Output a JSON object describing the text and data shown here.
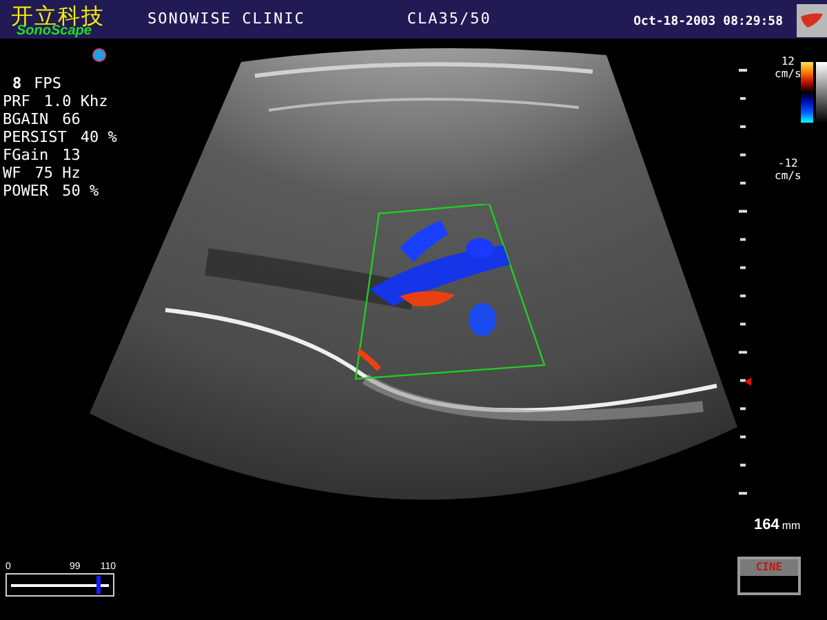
{
  "header": {
    "logo_cn": "开立科技",
    "logo_en": "SonoScape",
    "clinic": "SONOWISE CLINIC",
    "probe": "CLA35/50",
    "datetime": "Oct-18-2003 08:29:58"
  },
  "fps": {
    "value": "8",
    "unit": "FPS"
  },
  "params": [
    {
      "label": "PRF",
      "value": "1.0 Khz"
    },
    {
      "label": "BGAIN",
      "value": "66"
    },
    {
      "label": "PERSIST",
      "value": "40 %"
    },
    {
      "label": "FGain",
      "value": "13"
    },
    {
      "label": "WF",
      "value": "75 Hz"
    },
    {
      "label": "POWER",
      "value": "50 %"
    }
  ],
  "color_scale": {
    "max": "12",
    "max_unit": "cm/s",
    "min": "-12",
    "min_unit": "cm/s"
  },
  "depth": {
    "value": "164",
    "unit": "mm"
  },
  "cine_button": "CINE",
  "cine_slider": {
    "start": "0",
    "mark": "99",
    "end": "110",
    "level": 0.9
  }
}
